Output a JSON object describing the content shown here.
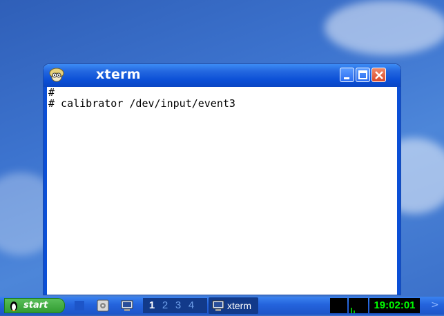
{
  "window": {
    "title": "xterm",
    "icon": "face-icon"
  },
  "terminal": {
    "lines": [
      "#",
      "# calibrator /dev/input/event3"
    ]
  },
  "taskbar": {
    "start_label": "start",
    "workspaces": [
      "1",
      "2",
      "3",
      "4"
    ],
    "active_task": "xterm",
    "clock": "19:02:01",
    "more_arrow": ">"
  },
  "colors": {
    "titlebar": "#0b4fd6",
    "clock_text": "#00ff00",
    "start_green": "#2f9a2f"
  }
}
